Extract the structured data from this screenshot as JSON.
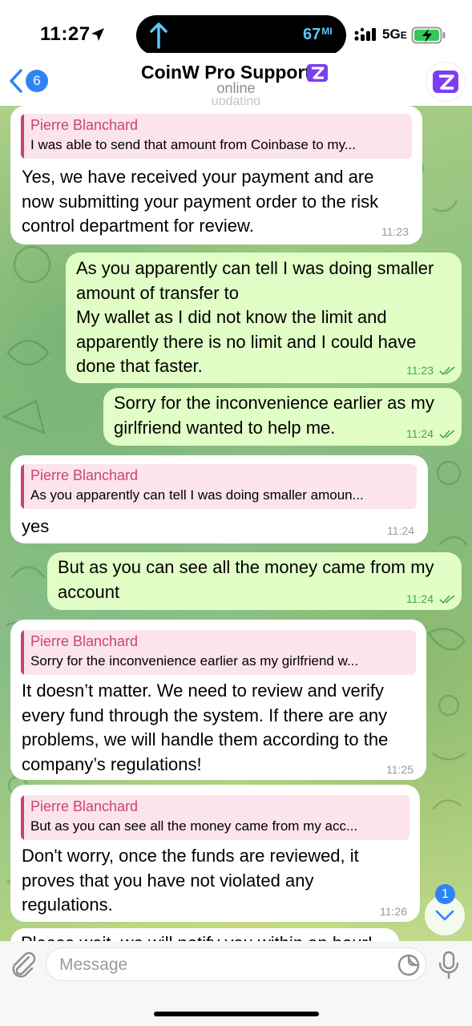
{
  "status_bar": {
    "time": "11:27",
    "speed_value": "67",
    "speed_unit": "MI",
    "network": "5G",
    "network_suffix": "E"
  },
  "header": {
    "back_badge": "6",
    "title": "CoinW Pro Support",
    "subtitle": "online",
    "subtitle2": "updating"
  },
  "messages": [
    {
      "direction": "in",
      "reply_name": "Pierre Blanchard",
      "reply_text": "I was able to send that amount from Coinbase to my...",
      "text": "Yes, we have received your payment and are\nnow submitting your payment order to the risk\ncontrol department for review.",
      "time": "11:23"
    },
    {
      "direction": "out",
      "text": "As you apparently can tell I was doing smaller\namount of transfer to\nMy wallet as I did not know the limit and\napparently there is no limit and I could have\ndone that faster.",
      "time": "11:23"
    },
    {
      "direction": "out",
      "text": "Sorry for the inconvenience earlier as my\ngirlfriend wanted to help me.",
      "time": "11:24"
    },
    {
      "direction": "in",
      "reply_name": "Pierre Blanchard",
      "reply_text": "As you apparently can tell I was doing smaller amoun...",
      "text": "yes",
      "time": "11:24"
    },
    {
      "direction": "out",
      "text": "But as you can see all the money came from my\naccount",
      "time": "11:24"
    },
    {
      "direction": "in",
      "reply_name": "Pierre Blanchard",
      "reply_text": "Sorry for the inconvenience earlier as my girlfriend w...",
      "text": "It doesn’t matter. We need to review and verify\nevery fund through the system. If there are any\nproblems, we will handle them according to the\ncompany’s regulations!",
      "time": "11:25"
    },
    {
      "direction": "in",
      "reply_name": "Pierre Blanchard",
      "reply_text": "But as you can see all the money came from my acc...",
      "text": "Don't worry, once the funds are reviewed, it\nproves that you have not violated any\nregulations.",
      "time": "11:26"
    }
  ],
  "partial_message": "Please wait, we will notify you within an hour!",
  "scroll_badge": "1",
  "composer": {
    "placeholder": "Message"
  },
  "colors": {
    "accent": "#2e84f6",
    "outgoing_bubble": "#e1fec6",
    "incoming_bubble": "#ffffff",
    "reply_name": "#c9437a",
    "reply_bg": "#fbe4ea",
    "read_checks": "#49a64e"
  },
  "icons": {
    "back": "chevron-left-icon",
    "title_badge": "coinw-logo-icon",
    "attach": "paperclip-icon",
    "sticker": "sticker-icon",
    "mic": "microphone-icon",
    "scroll_down": "chevron-down-icon"
  }
}
